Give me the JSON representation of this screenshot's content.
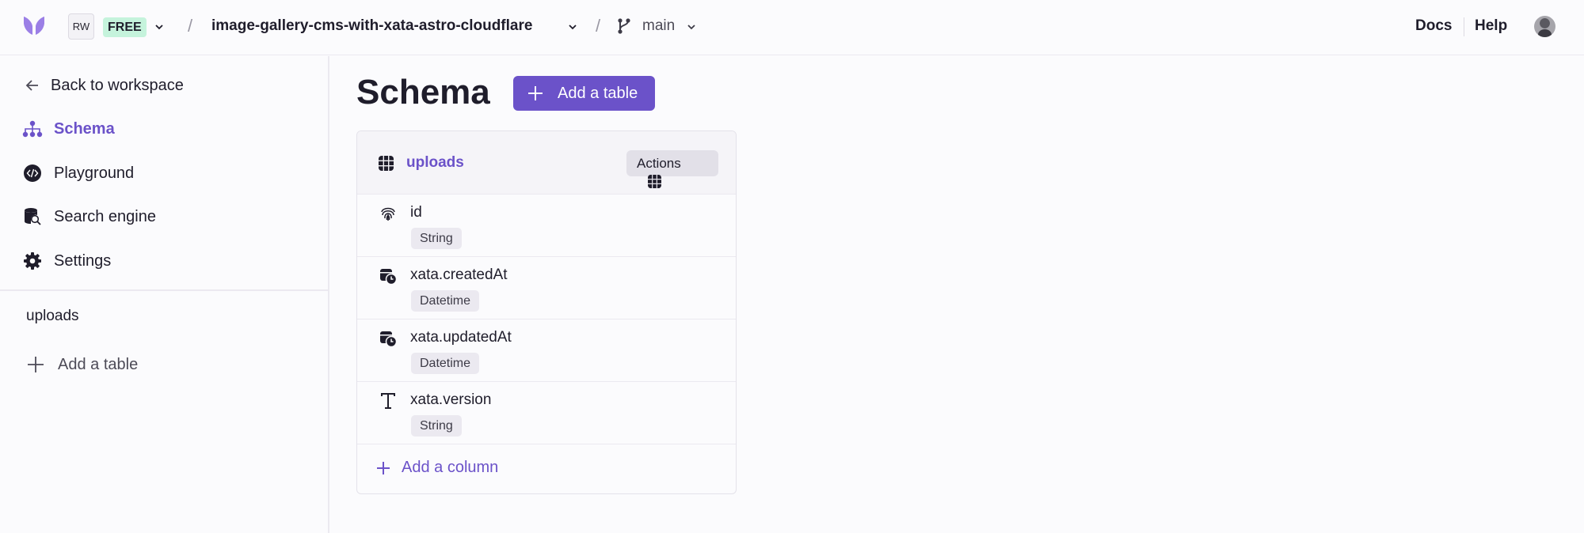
{
  "header": {
    "workspace_initials": "RW",
    "plan_badge": "FREE",
    "database_name": "image-gallery-cms-with-xata-astro-cloudflare",
    "branch_name": "main",
    "separator": "/",
    "docs_label": "Docs",
    "help_label": "Help"
  },
  "sidebar": {
    "back_label": "Back to workspace",
    "items": [
      {
        "label": "Schema",
        "icon": "sitemap-icon",
        "active": true
      },
      {
        "label": "Playground",
        "icon": "code-icon",
        "active": false
      },
      {
        "label": "Search engine",
        "icon": "database-search-icon",
        "active": false
      },
      {
        "label": "Settings",
        "icon": "gear-icon",
        "active": false
      }
    ],
    "tables": [
      "uploads"
    ],
    "add_table_label": "Add a table"
  },
  "main": {
    "title": "Schema",
    "add_table_button": "Add a table",
    "table": {
      "name": "uploads",
      "actions_label": "Actions",
      "columns": [
        {
          "name": "id",
          "type": "String",
          "icon": "fingerprint-icon"
        },
        {
          "name": "xata.createdAt",
          "type": "Datetime",
          "icon": "calendar-clock-icon"
        },
        {
          "name": "xata.updatedAt",
          "type": "Datetime",
          "icon": "calendar-clock-icon"
        },
        {
          "name": "xata.version",
          "type": "String",
          "icon": "text-icon"
        }
      ],
      "add_column_label": "Add a column"
    }
  },
  "colors": {
    "accent": "#6b52c9",
    "plan_badge_bg": "#c5f3dc",
    "logo": "#9b7fe6"
  }
}
